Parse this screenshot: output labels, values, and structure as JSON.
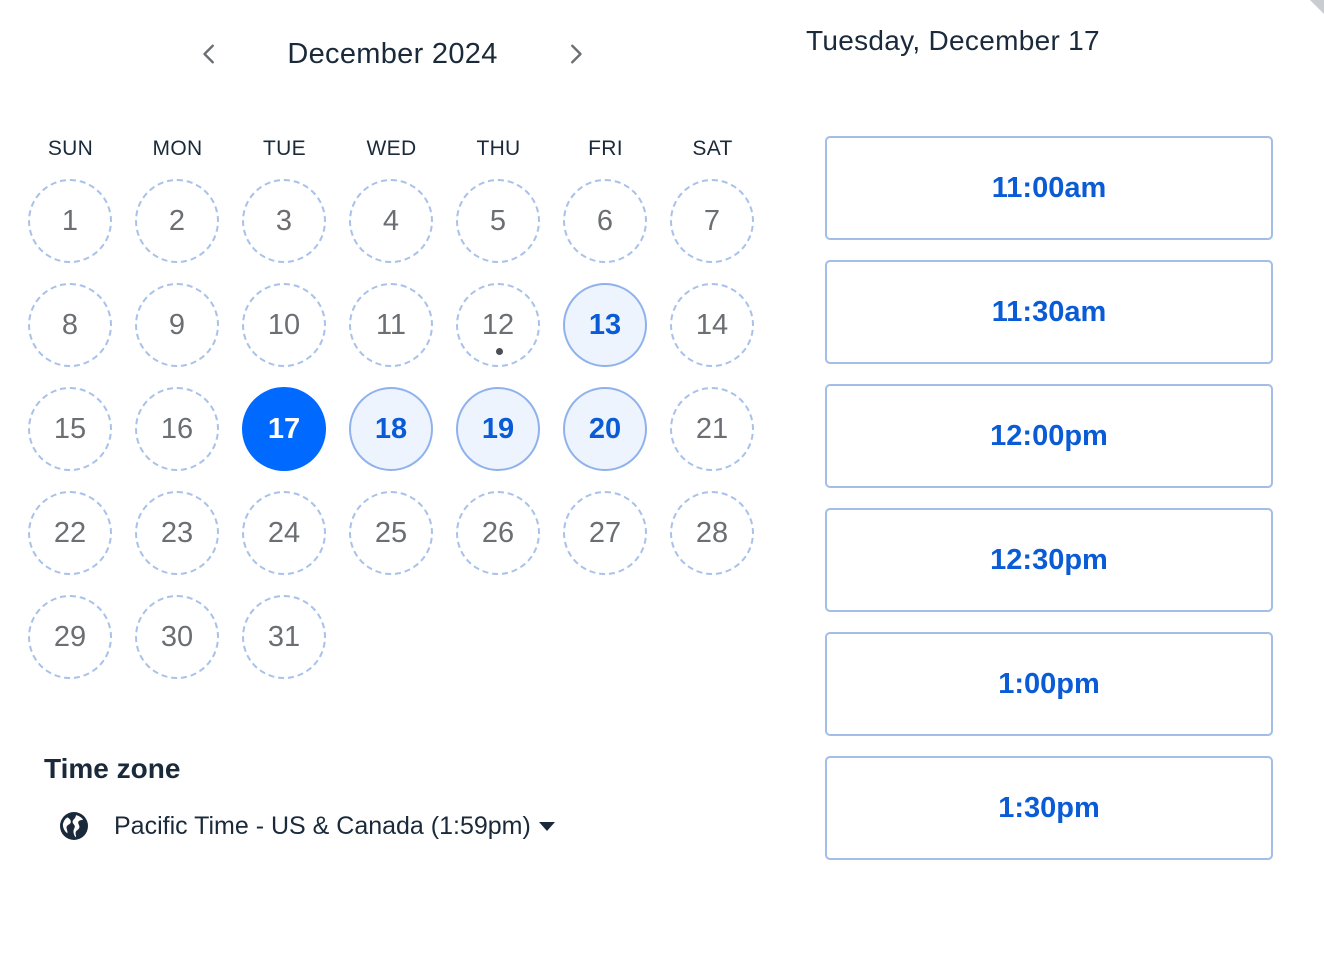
{
  "calendar": {
    "month_label": "December 2024",
    "weekdays": [
      "SUN",
      "MON",
      "TUE",
      "WED",
      "THU",
      "FRI",
      "SAT"
    ],
    "weeks": [
      [
        {
          "label": "1",
          "state": "unavailable"
        },
        {
          "label": "2",
          "state": "unavailable"
        },
        {
          "label": "3",
          "state": "unavailable"
        },
        {
          "label": "4",
          "state": "unavailable"
        },
        {
          "label": "5",
          "state": "unavailable"
        },
        {
          "label": "6",
          "state": "unavailable"
        },
        {
          "label": "7",
          "state": "unavailable"
        }
      ],
      [
        {
          "label": "8",
          "state": "unavailable"
        },
        {
          "label": "9",
          "state": "unavailable"
        },
        {
          "label": "10",
          "state": "unavailable"
        },
        {
          "label": "11",
          "state": "unavailable"
        },
        {
          "label": "12",
          "state": "unavailable",
          "today": true
        },
        {
          "label": "13",
          "state": "available"
        },
        {
          "label": "14",
          "state": "unavailable"
        }
      ],
      [
        {
          "label": "15",
          "state": "unavailable"
        },
        {
          "label": "16",
          "state": "unavailable"
        },
        {
          "label": "17",
          "state": "selected"
        },
        {
          "label": "18",
          "state": "available"
        },
        {
          "label": "19",
          "state": "available"
        },
        {
          "label": "20",
          "state": "available"
        },
        {
          "label": "21",
          "state": "unavailable"
        }
      ],
      [
        {
          "label": "22",
          "state": "unavailable"
        },
        {
          "label": "23",
          "state": "unavailable"
        },
        {
          "label": "24",
          "state": "unavailable"
        },
        {
          "label": "25",
          "state": "unavailable"
        },
        {
          "label": "26",
          "state": "unavailable"
        },
        {
          "label": "27",
          "state": "unavailable"
        },
        {
          "label": "28",
          "state": "unavailable"
        }
      ],
      [
        {
          "label": "29",
          "state": "unavailable"
        },
        {
          "label": "30",
          "state": "unavailable"
        },
        {
          "label": "31",
          "state": "unavailable"
        }
      ]
    ],
    "icons": {
      "prev": "chevron-left-icon",
      "next": "chevron-right-icon"
    }
  },
  "timezone": {
    "heading": "Time zone",
    "value": "Pacific Time - US & Canada (1:59pm)",
    "icon": "globe-icon",
    "caret_icon": "caret-down-icon"
  },
  "schedule": {
    "selected_date": "Tuesday, December 17",
    "slots": [
      "11:00am",
      "11:30am",
      "12:00pm",
      "12:30pm",
      "1:00pm",
      "1:30pm"
    ]
  },
  "colors": {
    "accent": "#0069ff",
    "available_bg": "#eef4fd",
    "available_text": "#0a5bd6",
    "slot_border": "#a3bde9",
    "dashed_border": "#a9c2ea",
    "text": "#1a2a3a"
  }
}
